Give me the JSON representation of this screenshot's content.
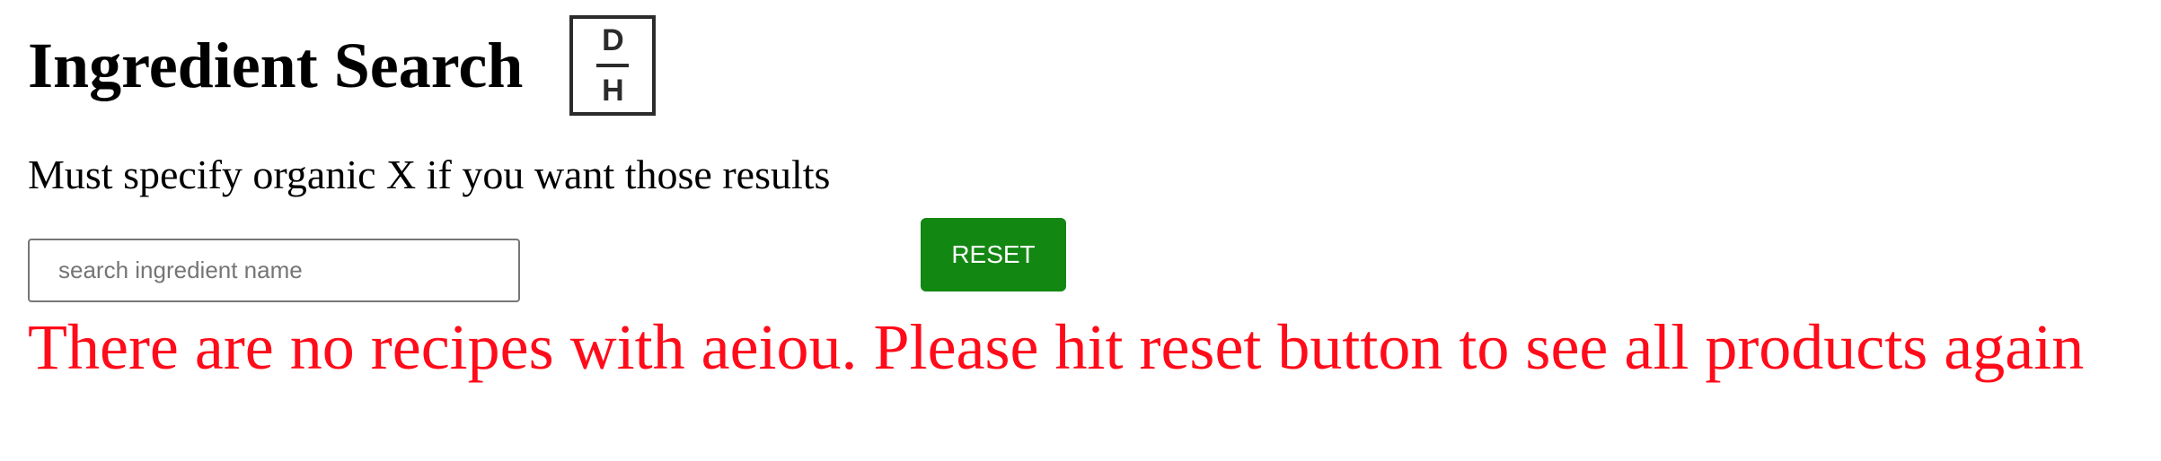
{
  "header": {
    "title": "Ingredient Search",
    "logo": {
      "top_letter": "D",
      "bottom_letter": "H"
    }
  },
  "notice": "Must specify organic X if you want those results",
  "search": {
    "placeholder": "search ingredient name",
    "value": ""
  },
  "reset_button": {
    "label": "RESET"
  },
  "error_message": "There are no recipes with aeiou. Please hit reset button to see all products again",
  "colors": {
    "reset_button_bg": "#128712",
    "error_text": "#ff0b1a",
    "logo_border": "#2b2b2b"
  }
}
